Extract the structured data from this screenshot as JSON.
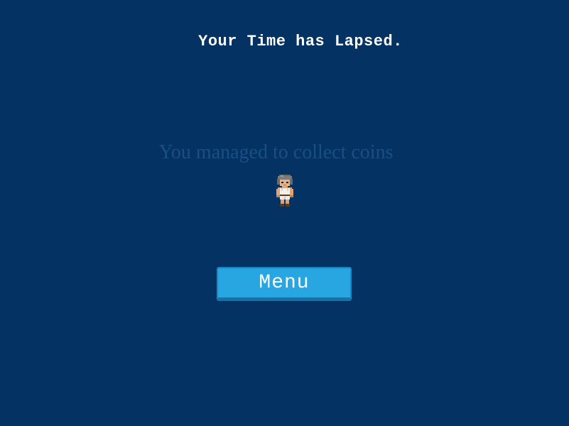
{
  "game": {
    "title": "Your Time has Lapsed.",
    "result_text": "You managed to collect coins",
    "menu_label": "Menu",
    "character_icon": "player-character-sprite",
    "colors": {
      "background": "#033263",
      "title": "#ffffff",
      "result_text": "#1a4f85",
      "button": "#27a6e2"
    }
  }
}
